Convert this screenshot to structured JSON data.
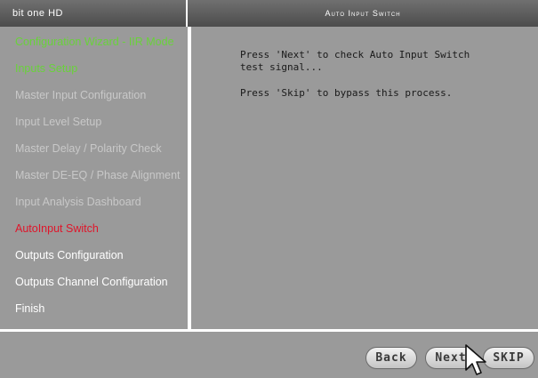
{
  "titlebar": {
    "app_name": "bit one HD",
    "page_title": "Auto Input Switch"
  },
  "sidebar": {
    "items": [
      {
        "label": "Configuration Wizard - IIR Mode",
        "state": "completed"
      },
      {
        "label": "Inputs Setup",
        "state": "completed"
      },
      {
        "label": "Master Input Configuration",
        "state": "pending"
      },
      {
        "label": "Input Level Setup",
        "state": "pending"
      },
      {
        "label": "Master Delay / Polarity Check",
        "state": "pending"
      },
      {
        "label": "Master DE-EQ / Phase Alignment",
        "state": "pending"
      },
      {
        "label": "Input Analysis Dashboard",
        "state": "pending"
      },
      {
        "label": "AutoInput Switch",
        "state": "current"
      },
      {
        "label": "Outputs Configuration",
        "state": "upcoming"
      },
      {
        "label": "Outputs Channel Configuration",
        "state": "upcoming"
      },
      {
        "label": "Finish",
        "state": "upcoming"
      }
    ]
  },
  "main": {
    "message_next": "Press 'Next' to check Auto Input Switch\ntest signal...",
    "message_skip": "Press 'Skip' to bypass this process."
  },
  "footer": {
    "back_label": "Back",
    "next_label": "Next",
    "skip_label": "SKIP"
  },
  "colors": {
    "completed": "#69d23a",
    "pending": "#c8c8c8",
    "current": "#e0152a",
    "upcoming": "#ffffff",
    "panel": "#9a9a9a"
  }
}
